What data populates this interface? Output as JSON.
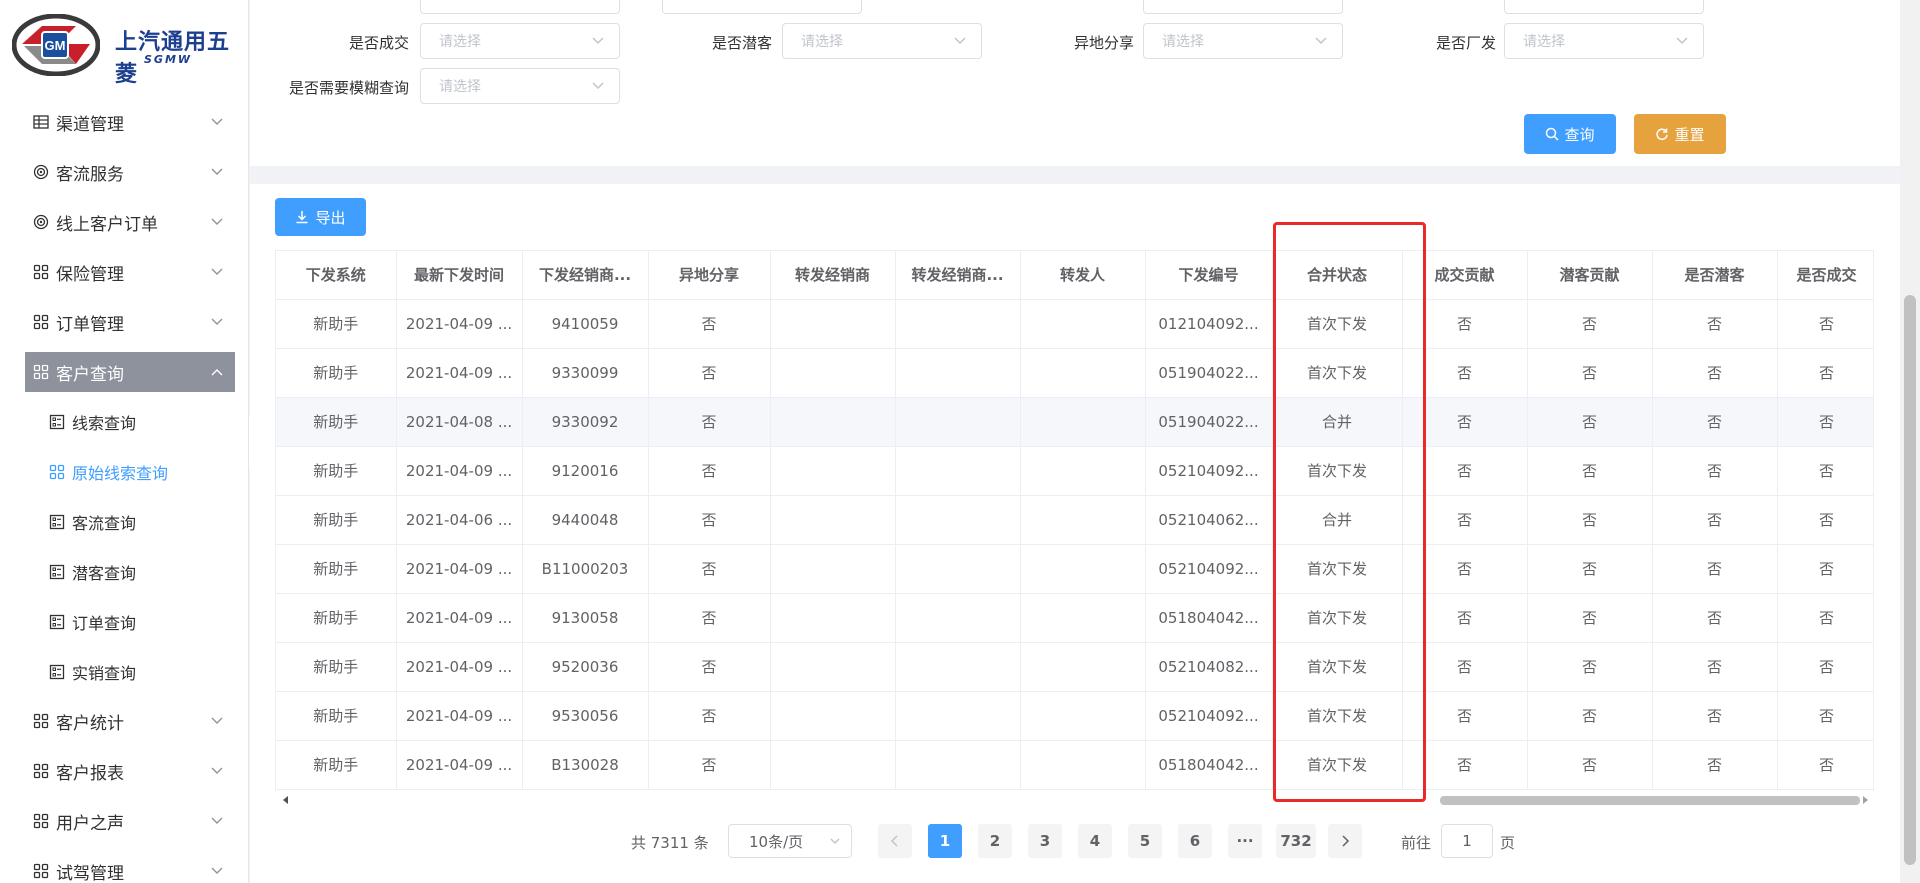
{
  "brand": {
    "name_cn": "上汽通用五菱",
    "name_en": "SGMW",
    "badge_text": "GM"
  },
  "sidebar": {
    "items": [
      {
        "label": "渠道管理",
        "icon": "table-icon"
      },
      {
        "label": "客流服务",
        "icon": "target-icon"
      },
      {
        "label": "线上客户订单",
        "icon": "target-icon"
      },
      {
        "label": "保险管理",
        "icon": "grid-icon"
      },
      {
        "label": "订单管理",
        "icon": "grid-icon"
      },
      {
        "label": "客户查询",
        "icon": "grid-icon"
      },
      {
        "label": "客户统计",
        "icon": "grid-icon"
      },
      {
        "label": "客户报表",
        "icon": "grid-icon"
      },
      {
        "label": "用户之声",
        "icon": "grid-icon"
      },
      {
        "label": "试驾管理",
        "icon": "grid-icon"
      }
    ],
    "subitems": [
      {
        "label": "线索查询"
      },
      {
        "label": "原始线索查询"
      },
      {
        "label": "客流查询"
      },
      {
        "label": "潜客查询"
      },
      {
        "label": "订单查询"
      },
      {
        "label": "实销查询"
      }
    ]
  },
  "filters": {
    "placeholder": "请选择",
    "row2": [
      {
        "label": "是否成交"
      },
      {
        "label": "是否潜客"
      },
      {
        "label": "异地分享"
      },
      {
        "label": "是否厂发"
      }
    ],
    "row3": [
      {
        "label": "是否需要模糊查询"
      }
    ]
  },
  "actions": {
    "query_label": "查询",
    "reset_label": "重置",
    "export_label": "导出"
  },
  "table": {
    "columns": [
      "下发系统",
      "最新下发时间",
      "下发经销商...",
      "异地分享",
      "转发经销商",
      "转发经销商...",
      "转发人",
      "下发编号",
      "合并状态",
      "成交贡献",
      "潜客贡献",
      "是否潜客",
      "是否成交"
    ],
    "rows": [
      [
        "新助手",
        "2021-04-09 ...",
        "9410059",
        "否",
        "",
        "",
        "",
        "012104092...",
        "首次下发",
        "否",
        "否",
        "否",
        "否"
      ],
      [
        "新助手",
        "2021-04-09 ...",
        "9330099",
        "否",
        "",
        "",
        "",
        "051904022...",
        "首次下发",
        "否",
        "否",
        "否",
        "否"
      ],
      [
        "新助手",
        "2021-04-08 ...",
        "9330092",
        "否",
        "",
        "",
        "",
        "051904022...",
        "合并",
        "否",
        "否",
        "否",
        "否"
      ],
      [
        "新助手",
        "2021-04-09 ...",
        "9120016",
        "否",
        "",
        "",
        "",
        "052104092...",
        "首次下发",
        "否",
        "否",
        "否",
        "否"
      ],
      [
        "新助手",
        "2021-04-06 ...",
        "9440048",
        "否",
        "",
        "",
        "",
        "052104062...",
        "合并",
        "否",
        "否",
        "否",
        "否"
      ],
      [
        "新助手",
        "2021-04-09 ...",
        "B11000203",
        "否",
        "",
        "",
        "",
        "052104092...",
        "首次下发",
        "否",
        "否",
        "否",
        "否"
      ],
      [
        "新助手",
        "2021-04-09 ...",
        "9130058",
        "否",
        "",
        "",
        "",
        "051804042...",
        "首次下发",
        "否",
        "否",
        "否",
        "否"
      ],
      [
        "新助手",
        "2021-04-09 ...",
        "9520036",
        "否",
        "",
        "",
        "",
        "052104082...",
        "首次下发",
        "否",
        "否",
        "否",
        "否"
      ],
      [
        "新助手",
        "2021-04-09 ...",
        "9530056",
        "否",
        "",
        "",
        "",
        "052104092...",
        "首次下发",
        "否",
        "否",
        "否",
        "否"
      ],
      [
        "新助手",
        "2021-04-09 ...",
        "B130028",
        "否",
        "",
        "",
        "",
        "051804042...",
        "首次下发",
        "否",
        "否",
        "否",
        "否"
      ]
    ]
  },
  "pagination": {
    "total_text": "共 7311 条",
    "page_size": "10条/页",
    "pages": [
      "1",
      "2",
      "3",
      "4",
      "5",
      "6",
      "···",
      "732"
    ],
    "goto_prefix": "前往",
    "goto_value": "1",
    "goto_suffix": "页"
  },
  "colors": {
    "primary": "#409eff",
    "warning": "#e6a23c",
    "highlight": "#ea2a2a",
    "menu_active_bg": "#8d929c"
  }
}
